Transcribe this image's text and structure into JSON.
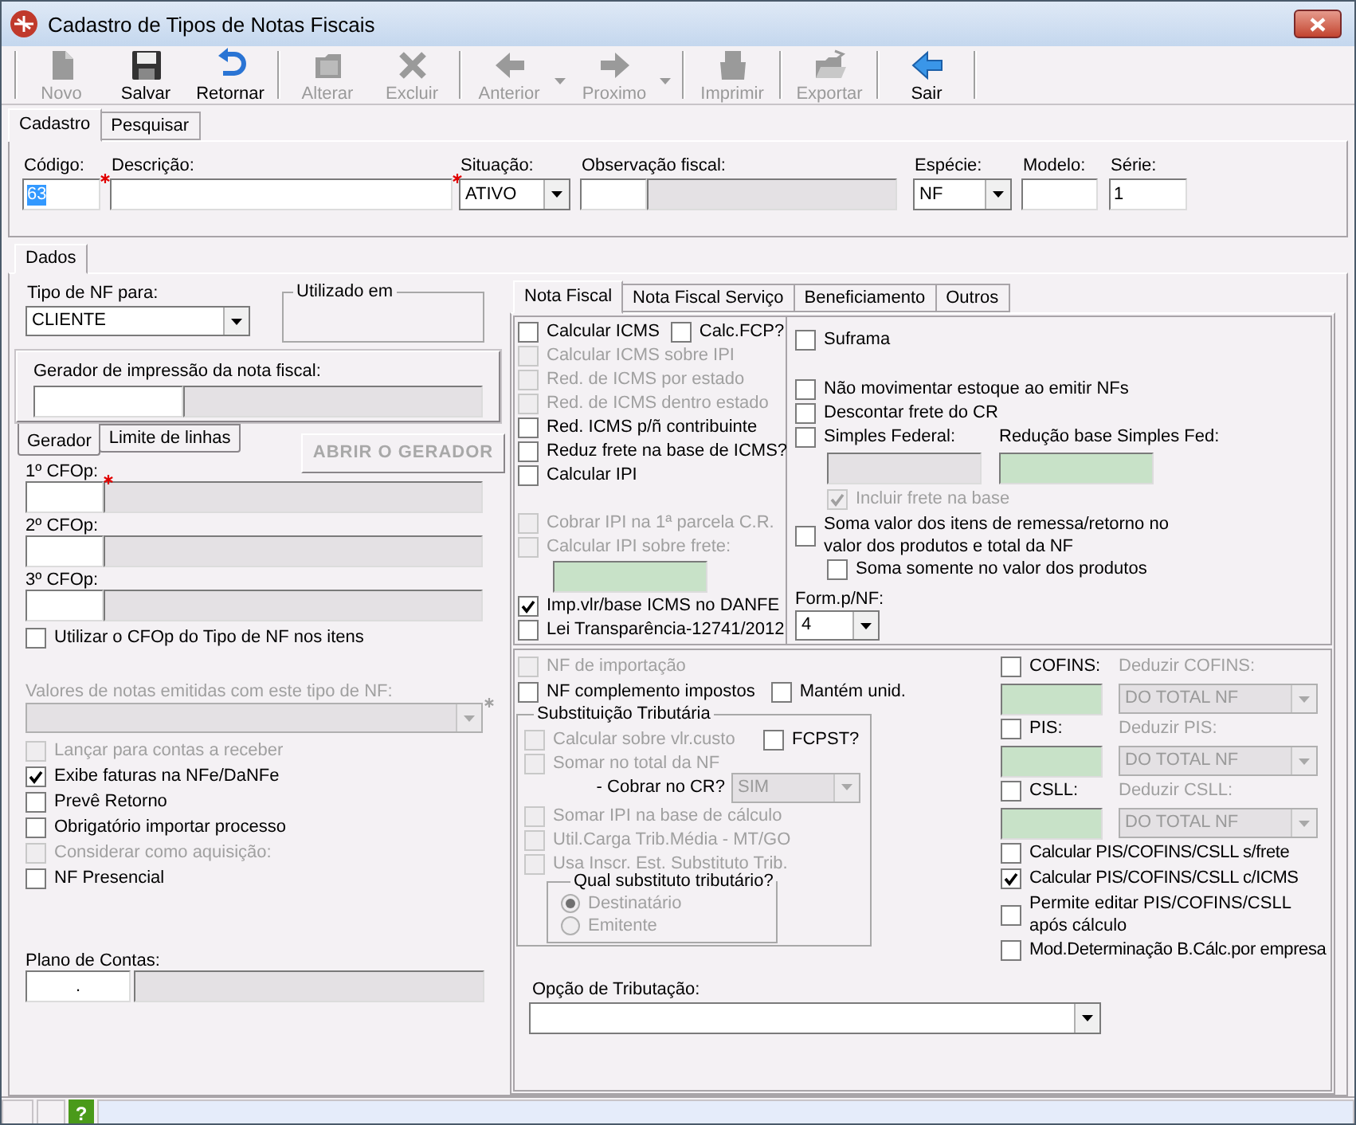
{
  "window": {
    "title": "Cadastro de Tipos de Notas Fiscais"
  },
  "toolbar": [
    {
      "buttons": [
        {
          "label": "Novo",
          "disabled": true,
          "menu": false
        },
        {
          "label": "Salvar",
          "disabled": false,
          "menu": false
        },
        {
          "label": "Retornar",
          "disabled": false,
          "menu": false
        }
      ]
    },
    {
      "buttons": [
        {
          "label": "Alterar",
          "disabled": true,
          "menu": false
        },
        {
          "label": "Excluir",
          "disabled": true,
          "menu": false
        }
      ]
    },
    {
      "buttons": [
        {
          "label": "Anterior",
          "disabled": true,
          "menu": true
        },
        {
          "label": "Proximo",
          "disabled": true,
          "menu": true
        }
      ]
    },
    {
      "buttons": [
        {
          "label": "Imprimir",
          "disabled": true,
          "menu": false
        }
      ]
    },
    {
      "buttons": [
        {
          "label": "Exportar",
          "disabled": true,
          "menu": false
        }
      ]
    },
    {
      "buttons": [
        {
          "label": "Sair",
          "disabled": false,
          "menu": false
        }
      ]
    }
  ],
  "tabs": [
    {
      "label": "Cadastro",
      "selected": true
    },
    {
      "label": "Pesquisar",
      "selected": false
    }
  ],
  "header_fields": [
    {
      "kind": "text",
      "label": "Código:",
      "value": "63",
      "required": true,
      "value_selected": true
    },
    {
      "kind": "text",
      "label": "Descrição:",
      "required": true
    },
    {
      "kind": "combo",
      "label": "Situação:",
      "value": "ATIVO",
      "required": false
    },
    {
      "kind": "lookup",
      "label": "Observação fiscal:",
      "required": false
    },
    {
      "kind": "combo",
      "label": "Espécie:",
      "value": "NF",
      "required": false
    },
    {
      "kind": "text",
      "label": "Modelo:",
      "required": false
    },
    {
      "kind": "text",
      "label": "Série:",
      "value": "1",
      "required": false,
      "value_selected": false
    }
  ],
  "dados_tab": {
    "label": "Dados"
  },
  "tipo_nf": {
    "label": "Tipo de NF para:",
    "value": "CLIENTE"
  },
  "utilizado_em": {
    "title": "Utilizado em"
  },
  "gerador": {
    "label": "Gerador de impressão da nota fiscal:"
  },
  "gerador_tabs": [
    {
      "label": "Gerador",
      "selected": true
    },
    {
      "label": "Limite de linhas",
      "selected": false
    }
  ],
  "abrir_gerador": {
    "label": "ABRIR O GERADOR",
    "disabled": true
  },
  "cfops": [
    {
      "label": "1º CFOp:",
      "required": true
    },
    {
      "label": "2º CFOp:",
      "required": false
    },
    {
      "label": "3º CFOp:",
      "required": false
    }
  ],
  "utilizar_cfop": {
    "label": "Utilizar o CFOp do Tipo de NF nos itens",
    "checked": false,
    "disabled": false
  },
  "valores": {
    "label": "Valores de notas emitidas com este tipo de NF:",
    "disabled": true,
    "required": true
  },
  "left_options": [
    {
      "label": "Lançar para contas a receber",
      "checked": false,
      "disabled": true
    },
    {
      "label": "Exibe faturas na NFe/DaNFe",
      "checked": true,
      "disabled": false
    },
    {
      "label": "Prevê Retorno",
      "checked": false,
      "disabled": false
    },
    {
      "label": "Obrigatório importar processo",
      "checked": false,
      "disabled": false
    },
    {
      "label": "Considerar como aquisição:",
      "checked": false,
      "disabled": true
    },
    {
      "label": "NF Presencial",
      "checked": false,
      "disabled": false
    }
  ],
  "plano_contas": {
    "label": "Plano de Contas:",
    "value": "."
  },
  "nf_tabs": [
    {
      "label": "Nota Fiscal",
      "selected": true
    },
    {
      "label": "Nota Fiscal Serviço",
      "selected": false
    },
    {
      "label": "Beneficiamento",
      "selected": false
    },
    {
      "label": "Outros",
      "selected": false
    }
  ],
  "icms_rows": [
    [
      {
        "label": "Calcular ICMS",
        "checked": false,
        "disabled": false
      },
      {
        "label": "Calc.FCP?",
        "checked": false,
        "disabled": false
      }
    ],
    [
      {
        "label": "Calcular ICMS sobre IPI",
        "checked": false,
        "disabled": true
      }
    ],
    [
      {
        "label": "Red. de ICMS por estado",
        "checked": false,
        "disabled": true
      }
    ],
    [
      {
        "label": "Red. de ICMS dentro estado",
        "checked": false,
        "disabled": true
      }
    ],
    [
      {
        "label": "Red. ICMS p/ñ contribuinte",
        "checked": false,
        "disabled": false
      }
    ],
    [
      {
        "label": "Reduz frete na base de ICMS?",
        "checked": false,
        "disabled": false
      }
    ],
    [
      {
        "label": "Calcular IPI",
        "checked": false,
        "disabled": false
      }
    ]
  ],
  "ipi_options": [
    {
      "label": "Cobrar IPI na 1ª parcela C.R.",
      "checked": false,
      "disabled": true
    },
    {
      "label": "Calcular IPI sobre frete:",
      "checked": false,
      "disabled": true
    }
  ],
  "danfe_options": [
    {
      "label": "Imp.vlr/base ICMS no DANFE",
      "checked": true,
      "disabled": false
    },
    {
      "label": "Lei Transparência-12741/2012",
      "checked": false,
      "disabled": false
    }
  ],
  "suframa": {
    "label": "Suframa",
    "checked": false,
    "disabled": false
  },
  "stock_options": [
    {
      "label": "Não movimentar estoque ao emitir NFs",
      "checked": false,
      "disabled": false
    },
    {
      "label": "Descontar frete do CR",
      "checked": false,
      "disabled": false
    },
    {
      "label": "Simples Federal:",
      "checked": false,
      "disabled": false
    }
  ],
  "simples_reduction": {
    "label": "Redução base Simples Fed:"
  },
  "incluir_frete": {
    "label": "Incluir frete na base",
    "checked": true,
    "disabled": true
  },
  "soma_remessa": {
    "label": "Soma valor dos itens de remessa/retorno no valor dos produtos e total da NF",
    "checked": false,
    "disabled": false
  },
  "soma_somente": {
    "label": "Soma somente no valor dos produtos",
    "checked": false,
    "disabled": false
  },
  "form_nf": {
    "label": "Form.p/NF:",
    "value": "4"
  },
  "nf_importacao": {
    "label": "NF de importação",
    "checked": false,
    "disabled": true
  },
  "complemento_row": [
    {
      "label": "NF complemento impostos",
      "checked": false,
      "disabled": false
    },
    {
      "label": "Mantém unid.",
      "checked": false,
      "disabled": false
    }
  ],
  "substituicao": {
    "title": "Substituição Tributária",
    "row_1": [
      {
        "label": "Calcular sobre vlr.custo",
        "checked": false,
        "disabled": true
      },
      {
        "label": "FCPST?",
        "checked": false,
        "disabled": false
      }
    ],
    "somar_total": {
      "label": "Somar no total da NF",
      "checked": false,
      "disabled": true
    },
    "cobrar_cr": {
      "label": "- Cobrar no CR?",
      "value": "SIM",
      "disabled": true
    },
    "more_options": [
      {
        "label": "Somar IPI na base de cálculo",
        "checked": false,
        "disabled": true
      },
      {
        "label": "Util.Carga Trib.Média - MT/GO",
        "checked": false,
        "disabled": true
      },
      {
        "label": "Usa Inscr. Est. Substituto Trib.",
        "checked": false,
        "disabled": true
      }
    ],
    "substituto": {
      "title": "Qual substituto tributário?",
      "options": [
        {
          "label": "Destinatário",
          "selected": true,
          "disabled": true
        },
        {
          "label": "Emitente",
          "selected": false,
          "disabled": true
        }
      ]
    }
  },
  "taxes": [
    {
      "label": "COFINS:",
      "checked": false,
      "deduct_label": "Deduzir COFINS:",
      "deduct_value": "DO TOTAL NF",
      "deduct_disabled": true
    },
    {
      "label": "PIS:",
      "checked": false,
      "deduct_label": "Deduzir PIS:",
      "deduct_value": "DO TOTAL NF",
      "deduct_disabled": true
    },
    {
      "label": "CSLL:",
      "checked": false,
      "deduct_label": "Deduzir CSLL:",
      "deduct_value": "DO TOTAL NF",
      "deduct_disabled": true
    }
  ],
  "tax_options": [
    {
      "label": "Calcular PIS/COFINS/CSLL s/frete",
      "checked": false,
      "disabled": false
    },
    {
      "label": "Calcular PIS/COFINS/CSLL c/ICMS",
      "checked": true,
      "disabled": false
    },
    {
      "label": "Permite editar PIS/COFINS/CSLL após cálculo",
      "checked": false,
      "disabled": false
    },
    {
      "label": "Mod.Determinação B.Cálc.por empresa",
      "checked": false,
      "disabled": false
    }
  ],
  "tributacao": {
    "label": "Opção de Tributação:"
  },
  "status_bar": {
    "help": "?"
  }
}
